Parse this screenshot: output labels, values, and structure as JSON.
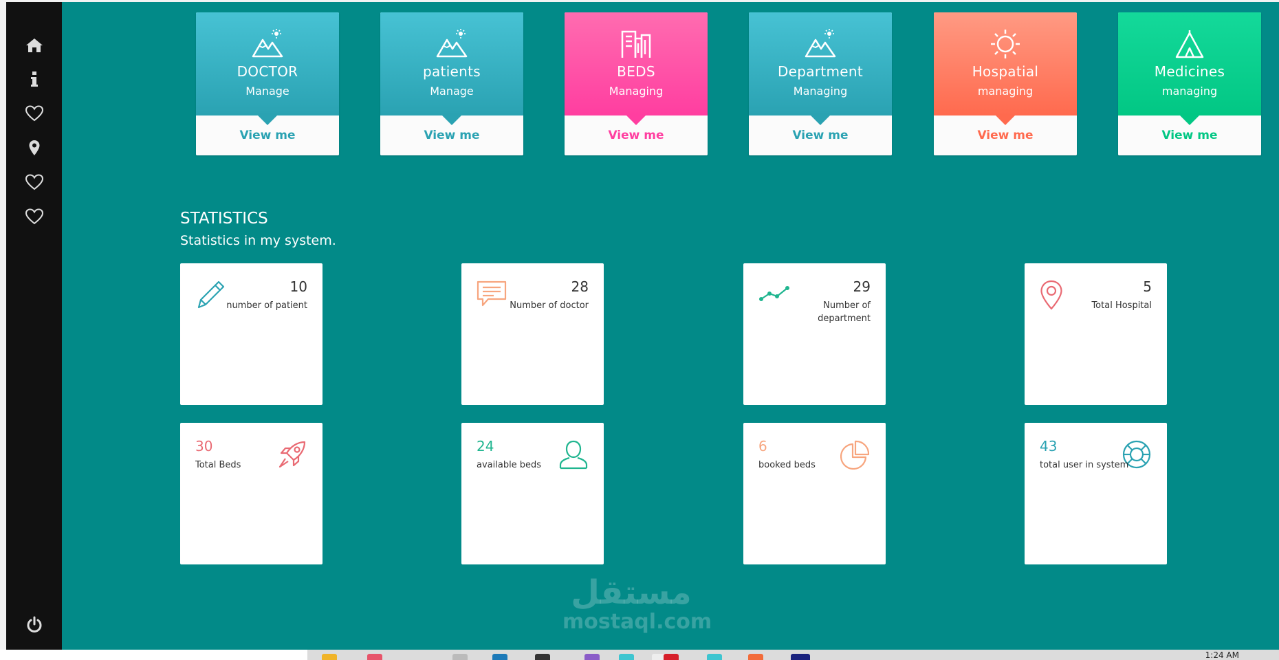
{
  "sidebar": {
    "items": [
      {
        "icon": "home-icon"
      },
      {
        "icon": "info-icon"
      },
      {
        "icon": "heart-icon"
      },
      {
        "icon": "map-pin-icon"
      },
      {
        "icon": "heart-icon"
      },
      {
        "icon": "heart-icon"
      }
    ],
    "logout_icon": "power-icon"
  },
  "cards": [
    {
      "title": "DOCTOR",
      "subtitle": "Manage",
      "link": "View me",
      "icon": "mountains-icon",
      "color": "#2aa2b2"
    },
    {
      "title": "patients",
      "subtitle": "Manage",
      "link": "View me",
      "icon": "mountains-icon",
      "color": "#2aa2b2"
    },
    {
      "title": "BEDS",
      "subtitle": "Managing",
      "link": "View me",
      "icon": "buildings-icon",
      "color": "#ff3ea0"
    },
    {
      "title": "Department",
      "subtitle": "Managing",
      "link": "View me",
      "icon": "mountains-icon",
      "color": "#2aa2b2"
    },
    {
      "title": "Hospatial",
      "subtitle": "managing",
      "link": "View me",
      "icon": "sun-icon",
      "color": "#ff6a4e"
    },
    {
      "title": "Medicines",
      "subtitle": "managing",
      "link": "View me",
      "icon": "tent-icon",
      "color": "#02c784"
    }
  ],
  "statistics": {
    "title": "STATISTICS",
    "subtitle": "Statistics in my system.",
    "items": [
      {
        "value": "10",
        "label": "number of patient",
        "icon": "pencil-icon",
        "color": "#2aa2b2"
      },
      {
        "value": "28",
        "label": "Number of doctor",
        "icon": "chat-icon",
        "color": "#f7a57e"
      },
      {
        "value": "29",
        "label": "Number of department",
        "icon": "line-chart-icon",
        "color": "#1fb58f"
      },
      {
        "value": "5",
        "label": "Total Hospital",
        "icon": "location-icon",
        "color": "#e96a73"
      },
      {
        "value": "30",
        "label": "Total Beds",
        "icon": "rocket-icon",
        "color": "#e96a73"
      },
      {
        "value": "24",
        "label": "available beds",
        "icon": "user-icon",
        "color": "#1fb58f"
      },
      {
        "value": "6",
        "label": "booked beds",
        "icon": "pie-chart-icon",
        "color": "#f7a57e"
      },
      {
        "value": "43",
        "label": "total user in system",
        "icon": "lifebuoy-icon",
        "color": "#2aa2b2"
      }
    ]
  },
  "watermark": {
    "arabic": "مستقل",
    "latin": "mostaql.com"
  },
  "taskbar": {
    "clock": "1:24 AM"
  }
}
